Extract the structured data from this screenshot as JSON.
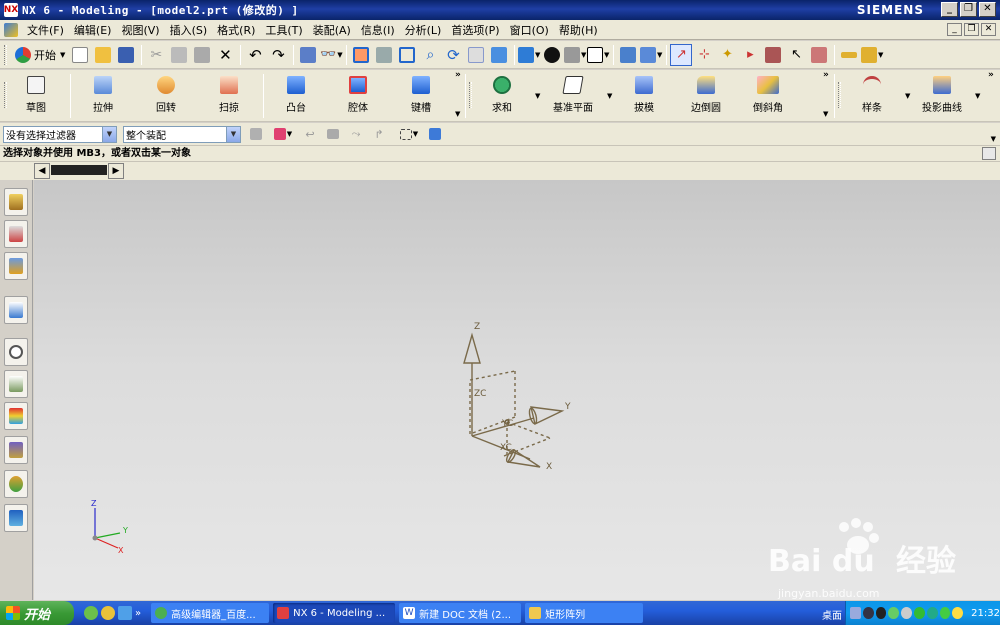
{
  "window": {
    "title": "NX 6 - Modeling - [model2.prt (修改的) ]",
    "brand": "SIEMENS",
    "app_icon": "nx-icon"
  },
  "menubar": {
    "items": [
      "文件(F)",
      "编辑(E)",
      "视图(V)",
      "插入(S)",
      "格式(R)",
      "工具(T)",
      "装配(A)",
      "信息(I)",
      "分析(L)",
      "首选项(P)",
      "窗口(O)",
      "帮助(H)"
    ]
  },
  "toolbar1": {
    "start_label": "开始"
  },
  "toolbar2": {
    "buttons": [
      "草图",
      "拉伸",
      "回转",
      "扫掠",
      "凸台",
      "腔体",
      "键槽",
      "求和",
      "基准平面",
      "拔模",
      "边倒圆",
      "倒斜角",
      "样条",
      "投影曲线"
    ]
  },
  "filters": {
    "selection_filter": "没有选择过滤器",
    "assembly_scope": "整个装配"
  },
  "prompt": {
    "text": "选择对象并使用 MB3，或者双击某一对象"
  },
  "viewport": {
    "csys_labels": {
      "z": "Z",
      "y": "Y",
      "x": "X",
      "zc": "ZC",
      "yc": "YC",
      "xc": "XC"
    },
    "triad_labels": {
      "z": "Z",
      "y": "Y",
      "x": "X"
    },
    "watermark": {
      "brand": "Bai  du",
      "brand_cn": "经验",
      "url": "jingyan.baidu.com"
    }
  },
  "taskbar": {
    "start_label": "开始",
    "tasks": [
      "高级编辑器_百度...",
      "NX 6 - Modeling ...",
      "新建 DOC 文档 (2...",
      "矩形阵列"
    ],
    "desktop_label": "桌面",
    "clock": "21:32"
  },
  "colors": {
    "titlebar": "#0a246a",
    "menubar": "#ece9d8",
    "viewport_top": "#c7c7c7",
    "viewport_bottom": "#e7e7e7",
    "csys": "#7a6a4a",
    "taskbar": "#245edb",
    "start_green": "#3a9a36"
  }
}
